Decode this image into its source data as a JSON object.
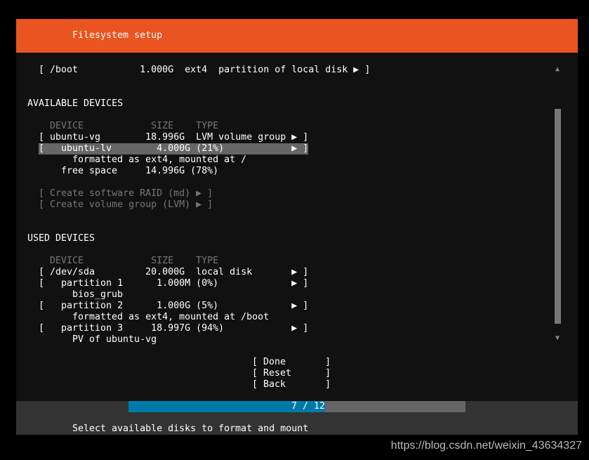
{
  "header": {
    "title": "Filesystem setup"
  },
  "boot_row": "[ /boot           1.000G  ext4  partition of local disk ▶ ]",
  "available": {
    "heading": "AVAILABLE DEVICES",
    "columns": "DEVICE            SIZE    TYPE",
    "rows": [
      "[ ubuntu-vg        18.996G  LVM volume group ▶ ]",
      "[   ubuntu-lv        4.000G (21%)            ▶ ]",
      "formatted as ext4, mounted at /",
      "free space     14.996G (78%)"
    ],
    "actions": [
      "[ Create software RAID (md) ▶ ]",
      "[ Create volume group (LVM) ▶ ]"
    ]
  },
  "used": {
    "heading": "USED DEVICES",
    "columns": "DEVICE            SIZE    TYPE",
    "rows": [
      "[ /dev/sda         20.000G  local disk       ▶ ]",
      "[   partition 1      1.000M (0%)             ▶ ]",
      "bios_grub",
      "[   partition 2      1.000G (5%)             ▶ ]",
      "formatted as ext4, mounted at /boot",
      "[   partition 3     18.997G (94%)            ▶ ]",
      "PV of ubuntu-vg"
    ]
  },
  "buttons": [
    "[ Done       ]",
    "[ Reset      ]",
    "[ Back       ]"
  ],
  "progress": {
    "label": "7 / 12",
    "current": 7,
    "total": 12,
    "fill_color": "#0079a8"
  },
  "status": "Select available disks to format and mount",
  "watermark": "https://blog.csdn.net/weixin_43634327",
  "colors": {
    "header": "#e95420",
    "highlight": "#666666"
  }
}
